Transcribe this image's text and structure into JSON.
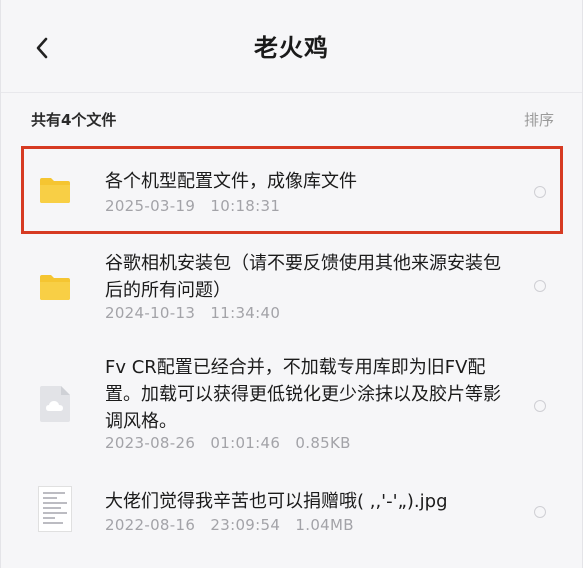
{
  "header": {
    "title": "老火鸡"
  },
  "listbar": {
    "count": "共有4个文件",
    "sort": "排序"
  },
  "files": [
    {
      "icon": "folder-icon",
      "name": "各个机型配置文件，成像库文件",
      "date": "2025-03-19",
      "time": "10:18:31",
      "size": ""
    },
    {
      "icon": "folder-icon",
      "name": "谷歌相机安装包（请不要反馈使用其他来源安装包后的所有问题）",
      "date": "2024-10-13",
      "time": "11:34:40",
      "size": ""
    },
    {
      "icon": "cloud-file-icon",
      "name": "Fv CR配置已经合并，不加载专用库即为旧FV配置。加载可以获得更低锐化更少涂抹以及胶片等影调风格。",
      "date": "2023-08-26",
      "time": "01:01:46",
      "size": "0.85KB"
    },
    {
      "icon": "image-thumbnail-icon",
      "name": "大佬们觉得我辛苦也可以捐赠哦( ,,'-'„).jpg",
      "date": "2022-08-16",
      "time": "23:09:54",
      "size": "1.04MB"
    }
  ],
  "colors": {
    "highlight": "#d63a22",
    "folder": "#f5c531",
    "background": "#f6f6f8"
  }
}
